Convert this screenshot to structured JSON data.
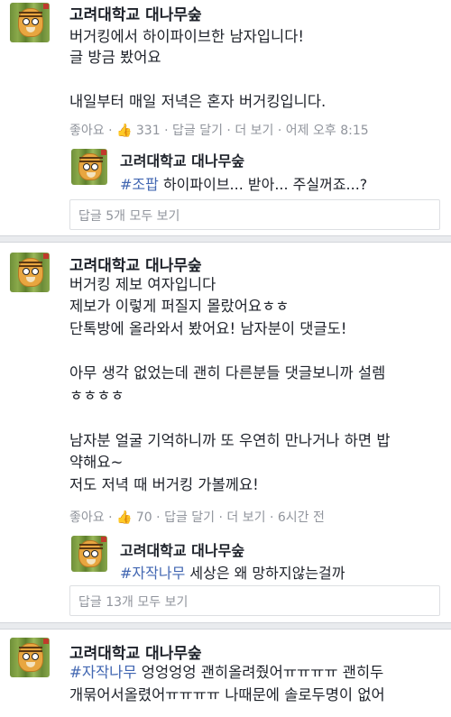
{
  "posts": [
    {
      "name": "고려대학교 대나무숲",
      "lines": [
        "버거킹에서 하이파이브한 남자입니다!",
        "글 방금 봤어요",
        "",
        "내일부터 매일 저녁은 혼자 버거킹입니다."
      ],
      "meta": {
        "like": "좋아요",
        "like_count": "331",
        "reply": "답글 달기",
        "more": "더 보기",
        "time": "어제 오후 8:15"
      },
      "reply": {
        "name": "고려대학교 대나무숲",
        "tag": "#조팝",
        "text": " 하이파이브... 받아... 주실꺼죠...?"
      },
      "view_all": "답글 5개 모두 보기"
    },
    {
      "name": "고려대학교 대나무숲",
      "lines": [
        "버거킹 제보 여자입니다",
        "제보가 이렇게 퍼질지 몰랐어요ㅎㅎ",
        "단톡방에 올라와서 봤어요! 남자분이 댓글도!",
        "",
        "아무 생각 없었는데 괜히 다른분들 댓글보니까 설렘",
        "ㅎㅎㅎㅎ",
        "",
        "남자분 얼굴 기억하니까 또 우연히 만나거나 하면 밥",
        "약해요~",
        "저도 저녁 때 버거킹 가볼께요!"
      ],
      "meta": {
        "like": "좋아요",
        "like_count": "70",
        "reply": "답글 달기",
        "more": "더 보기",
        "time": "6시간 전"
      },
      "reply": {
        "name": "고려대학교 대나무숲",
        "tag": "#자작나무",
        "text": " 세상은 왜 망하지않는걸까"
      },
      "view_all": "답글 13개 모두 보기"
    },
    {
      "name": "고려대학교 대나무숲",
      "tag": "#자작나무",
      "lines": [
        " 엉엉엉엉 괜히올려줬어ㅠㅠㅠㅠ 괜히두",
        "개묶어서올렸어ㅠㅠㅠㅠ 나때문에 솔로두명이 없어"
      ]
    }
  ],
  "icons": {
    "like": "thumbs-up-icon"
  },
  "colors": {
    "link": "#4267b2",
    "like_blue": "#5890ff",
    "meta_gray": "#90949c"
  }
}
